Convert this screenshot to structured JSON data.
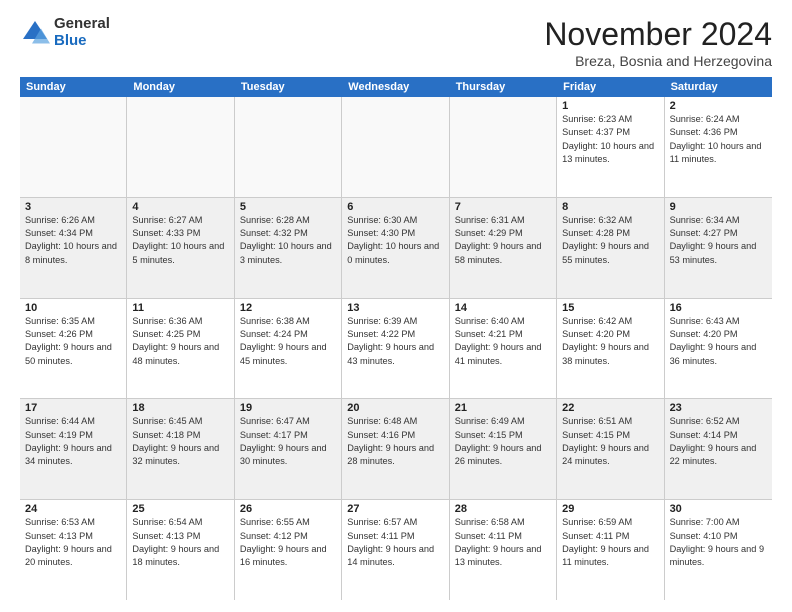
{
  "header": {
    "logo": {
      "general": "General",
      "blue": "Blue"
    },
    "title": "November 2024",
    "subtitle": "Breza, Bosnia and Herzegovina"
  },
  "days_of_week": [
    "Sunday",
    "Monday",
    "Tuesday",
    "Wednesday",
    "Thursday",
    "Friday",
    "Saturday"
  ],
  "weeks": [
    [
      {
        "day": "",
        "empty": true
      },
      {
        "day": "",
        "empty": true
      },
      {
        "day": "",
        "empty": true
      },
      {
        "day": "",
        "empty": true
      },
      {
        "day": "",
        "empty": true
      },
      {
        "day": "1",
        "sunrise": "6:23 AM",
        "sunset": "4:37 PM",
        "daylight": "10 hours and 13 minutes."
      },
      {
        "day": "2",
        "sunrise": "6:24 AM",
        "sunset": "4:36 PM",
        "daylight": "10 hours and 11 minutes."
      }
    ],
    [
      {
        "day": "3",
        "sunrise": "6:26 AM",
        "sunset": "4:34 PM",
        "daylight": "10 hours and 8 minutes."
      },
      {
        "day": "4",
        "sunrise": "6:27 AM",
        "sunset": "4:33 PM",
        "daylight": "10 hours and 5 minutes."
      },
      {
        "day": "5",
        "sunrise": "6:28 AM",
        "sunset": "4:32 PM",
        "daylight": "10 hours and 3 minutes."
      },
      {
        "day": "6",
        "sunrise": "6:30 AM",
        "sunset": "4:30 PM",
        "daylight": "10 hours and 0 minutes."
      },
      {
        "day": "7",
        "sunrise": "6:31 AM",
        "sunset": "4:29 PM",
        "daylight": "9 hours and 58 minutes."
      },
      {
        "day": "8",
        "sunrise": "6:32 AM",
        "sunset": "4:28 PM",
        "daylight": "9 hours and 55 minutes."
      },
      {
        "day": "9",
        "sunrise": "6:34 AM",
        "sunset": "4:27 PM",
        "daylight": "9 hours and 53 minutes."
      }
    ],
    [
      {
        "day": "10",
        "sunrise": "6:35 AM",
        "sunset": "4:26 PM",
        "daylight": "9 hours and 50 minutes."
      },
      {
        "day": "11",
        "sunrise": "6:36 AM",
        "sunset": "4:25 PM",
        "daylight": "9 hours and 48 minutes."
      },
      {
        "day": "12",
        "sunrise": "6:38 AM",
        "sunset": "4:24 PM",
        "daylight": "9 hours and 45 minutes."
      },
      {
        "day": "13",
        "sunrise": "6:39 AM",
        "sunset": "4:22 PM",
        "daylight": "9 hours and 43 minutes."
      },
      {
        "day": "14",
        "sunrise": "6:40 AM",
        "sunset": "4:21 PM",
        "daylight": "9 hours and 41 minutes."
      },
      {
        "day": "15",
        "sunrise": "6:42 AM",
        "sunset": "4:20 PM",
        "daylight": "9 hours and 38 minutes."
      },
      {
        "day": "16",
        "sunrise": "6:43 AM",
        "sunset": "4:20 PM",
        "daylight": "9 hours and 36 minutes."
      }
    ],
    [
      {
        "day": "17",
        "sunrise": "6:44 AM",
        "sunset": "4:19 PM",
        "daylight": "9 hours and 34 minutes."
      },
      {
        "day": "18",
        "sunrise": "6:45 AM",
        "sunset": "4:18 PM",
        "daylight": "9 hours and 32 minutes."
      },
      {
        "day": "19",
        "sunrise": "6:47 AM",
        "sunset": "4:17 PM",
        "daylight": "9 hours and 30 minutes."
      },
      {
        "day": "20",
        "sunrise": "6:48 AM",
        "sunset": "4:16 PM",
        "daylight": "9 hours and 28 minutes."
      },
      {
        "day": "21",
        "sunrise": "6:49 AM",
        "sunset": "4:15 PM",
        "daylight": "9 hours and 26 minutes."
      },
      {
        "day": "22",
        "sunrise": "6:51 AM",
        "sunset": "4:15 PM",
        "daylight": "9 hours and 24 minutes."
      },
      {
        "day": "23",
        "sunrise": "6:52 AM",
        "sunset": "4:14 PM",
        "daylight": "9 hours and 22 minutes."
      }
    ],
    [
      {
        "day": "24",
        "sunrise": "6:53 AM",
        "sunset": "4:13 PM",
        "daylight": "9 hours and 20 minutes."
      },
      {
        "day": "25",
        "sunrise": "6:54 AM",
        "sunset": "4:13 PM",
        "daylight": "9 hours and 18 minutes."
      },
      {
        "day": "26",
        "sunrise": "6:55 AM",
        "sunset": "4:12 PM",
        "daylight": "9 hours and 16 minutes."
      },
      {
        "day": "27",
        "sunrise": "6:57 AM",
        "sunset": "4:11 PM",
        "daylight": "9 hours and 14 minutes."
      },
      {
        "day": "28",
        "sunrise": "6:58 AM",
        "sunset": "4:11 PM",
        "daylight": "9 hours and 13 minutes."
      },
      {
        "day": "29",
        "sunrise": "6:59 AM",
        "sunset": "4:11 PM",
        "daylight": "9 hours and 11 minutes."
      },
      {
        "day": "30",
        "sunrise": "7:00 AM",
        "sunset": "4:10 PM",
        "daylight": "9 hours and 9 minutes."
      }
    ]
  ]
}
